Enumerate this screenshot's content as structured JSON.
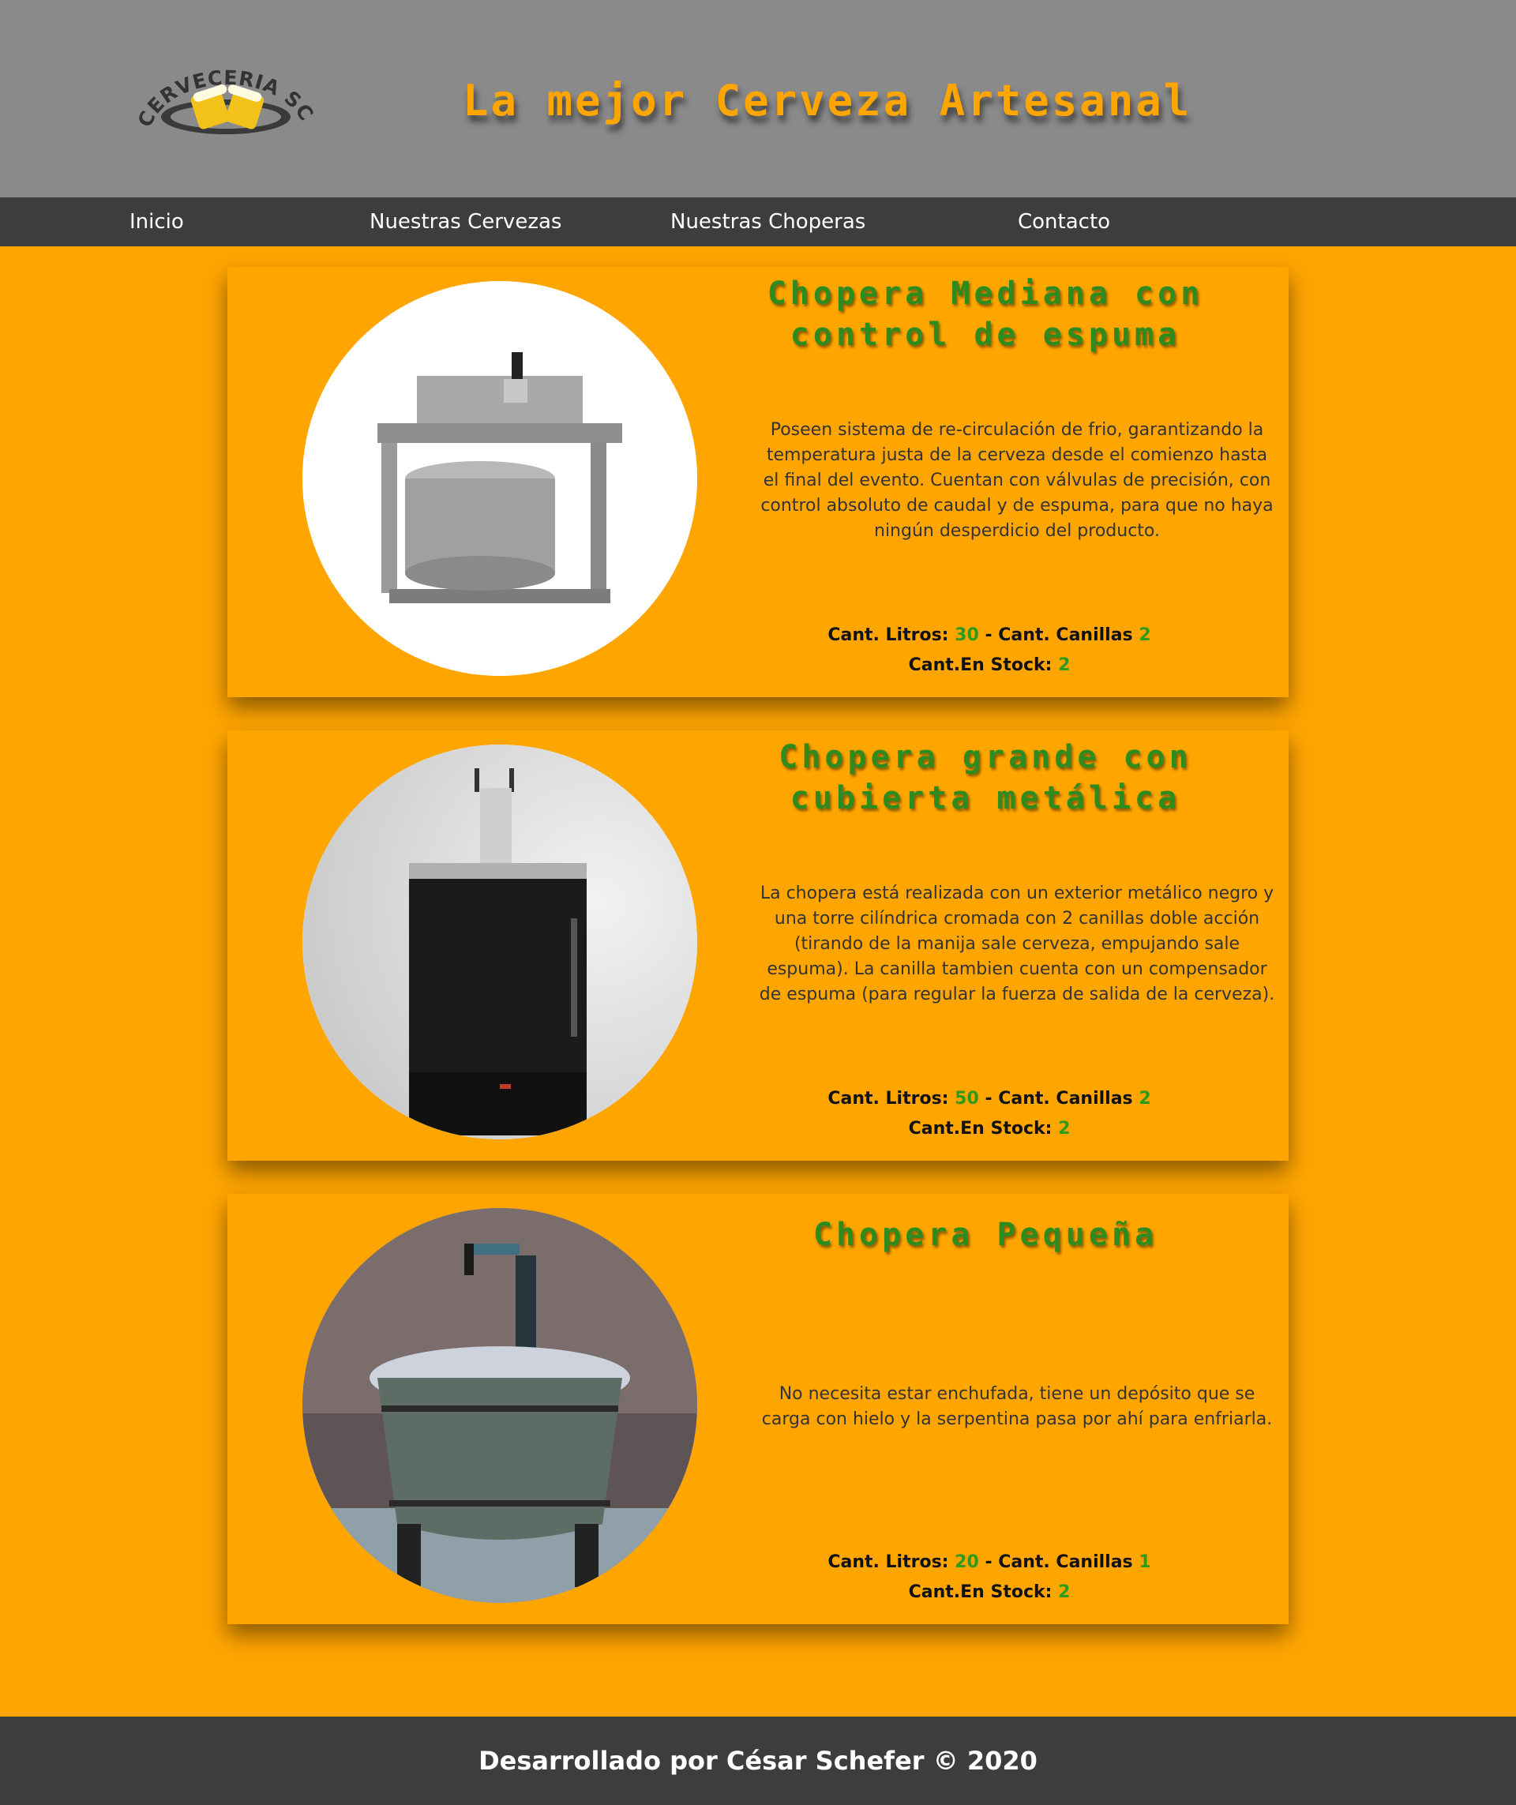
{
  "header": {
    "logo_text": "CERVECERIA SCHEFER",
    "title": "La mejor Cerveza Artesanal"
  },
  "nav": {
    "items": [
      {
        "label": "Inicio"
      },
      {
        "label": "Nuestras Cervezas"
      },
      {
        "label": "Nuestras Choperas"
      },
      {
        "label": "Contacto"
      }
    ]
  },
  "spec_labels": {
    "litros": "Cant. Litros:",
    "separator": "-",
    "canillas": "Cant. Canillas",
    "stock": "Cant.En Stock:"
  },
  "products": [
    {
      "title_line1": "Chopera Mediana con",
      "title_line2": "control de espuma",
      "image": "chopera-mediana-image",
      "description": "Poseen sistema de re-circulación de frio, garantizando la temperatura justa de la cerveza desde el comienzo hasta el final del evento. Cuentan con válvulas de precisión, con control absoluto de caudal y de espuma, para que no haya ningún desperdicio del producto.",
      "litros": "30",
      "canillas": "2",
      "stock": "2"
    },
    {
      "title_line1": "Chopera grande con",
      "title_line2": "cubierta metálica",
      "image": "chopera-grande-image",
      "description": "La chopera está realizada con un exterior metálico negro y una torre cilíndrica cromada con 2 canillas doble acción (tirando de la manija sale cerveza, empujando sale espuma). La canilla tambien cuenta con un compensador de espuma (para regular la fuerza de salida de la cerveza).",
      "litros": "50",
      "canillas": "2",
      "stock": "2"
    },
    {
      "title_line1": "Chopera Pequeña",
      "title_line2": "",
      "image": "chopera-pequena-image",
      "description": "No necesita estar enchufada, tiene un depósito que se carga con hielo y la serpentina pasa por ahí para enfriarla.",
      "litros": "20",
      "canillas": "1",
      "stock": "2"
    }
  ],
  "footer": {
    "text": "Desarrollado por César Schefer © 2020"
  },
  "colors": {
    "background": "#ffa500",
    "header": "#8a8a8a",
    "nav": "#3d3d3d",
    "title_green": "#2e8b1e",
    "value_green": "#2e9a1c"
  }
}
